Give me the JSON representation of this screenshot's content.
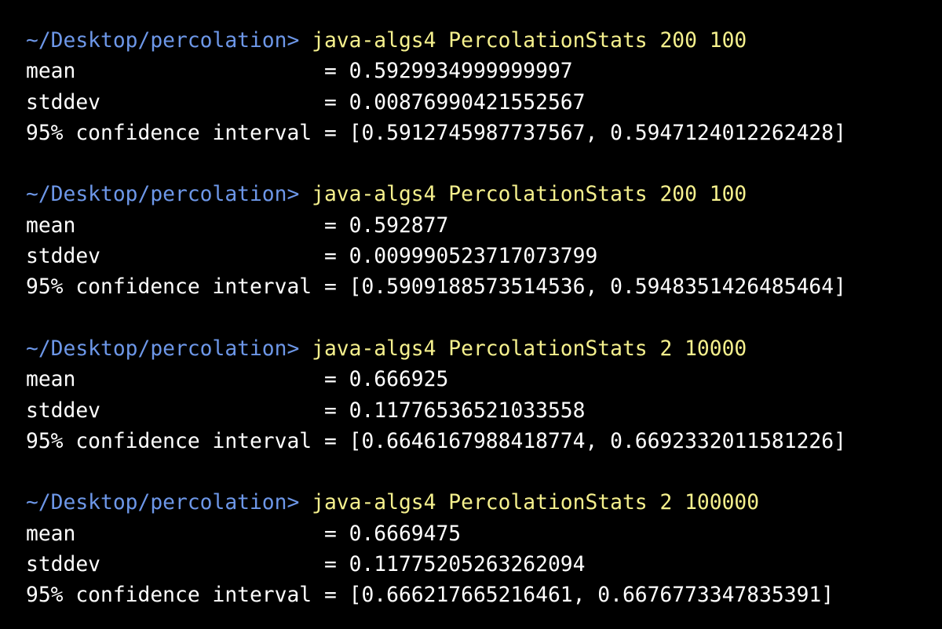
{
  "colors": {
    "background": "#000000",
    "prompt_path": "#6d97e8",
    "command": "#f5f08d",
    "output": "#ffffff"
  },
  "runs": [
    {
      "prompt": "~/Desktop/percolation> ",
      "command": "java-algs4 PercolationStats 200 100",
      "mean_line": "mean                    = 0.5929934999999997",
      "stddev_line": "stddev                  = 0.00876990421552567",
      "ci_line": "95% confidence interval = [0.5912745987737567, 0.5947124012262428]"
    },
    {
      "prompt": "~/Desktop/percolation> ",
      "command": "java-algs4 PercolationStats 200 100",
      "mean_line": "mean                    = 0.592877",
      "stddev_line": "stddev                  = 0.009990523717073799",
      "ci_line": "95% confidence interval = [0.5909188573514536, 0.5948351426485464]"
    },
    {
      "prompt": "~/Desktop/percolation> ",
      "command": "java-algs4 PercolationStats 2 10000",
      "mean_line": "mean                    = 0.666925",
      "stddev_line": "stddev                  = 0.11776536521033558",
      "ci_line": "95% confidence interval = [0.6646167988418774, 0.6692332011581226]"
    },
    {
      "prompt": "~/Desktop/percolation> ",
      "command": "java-algs4 PercolationStats 2 100000",
      "mean_line": "mean                    = 0.6669475",
      "stddev_line": "stddev                  = 0.11775205263262094",
      "ci_line": "95% confidence interval = [0.666217665216461, 0.6676773347835391]"
    }
  ]
}
